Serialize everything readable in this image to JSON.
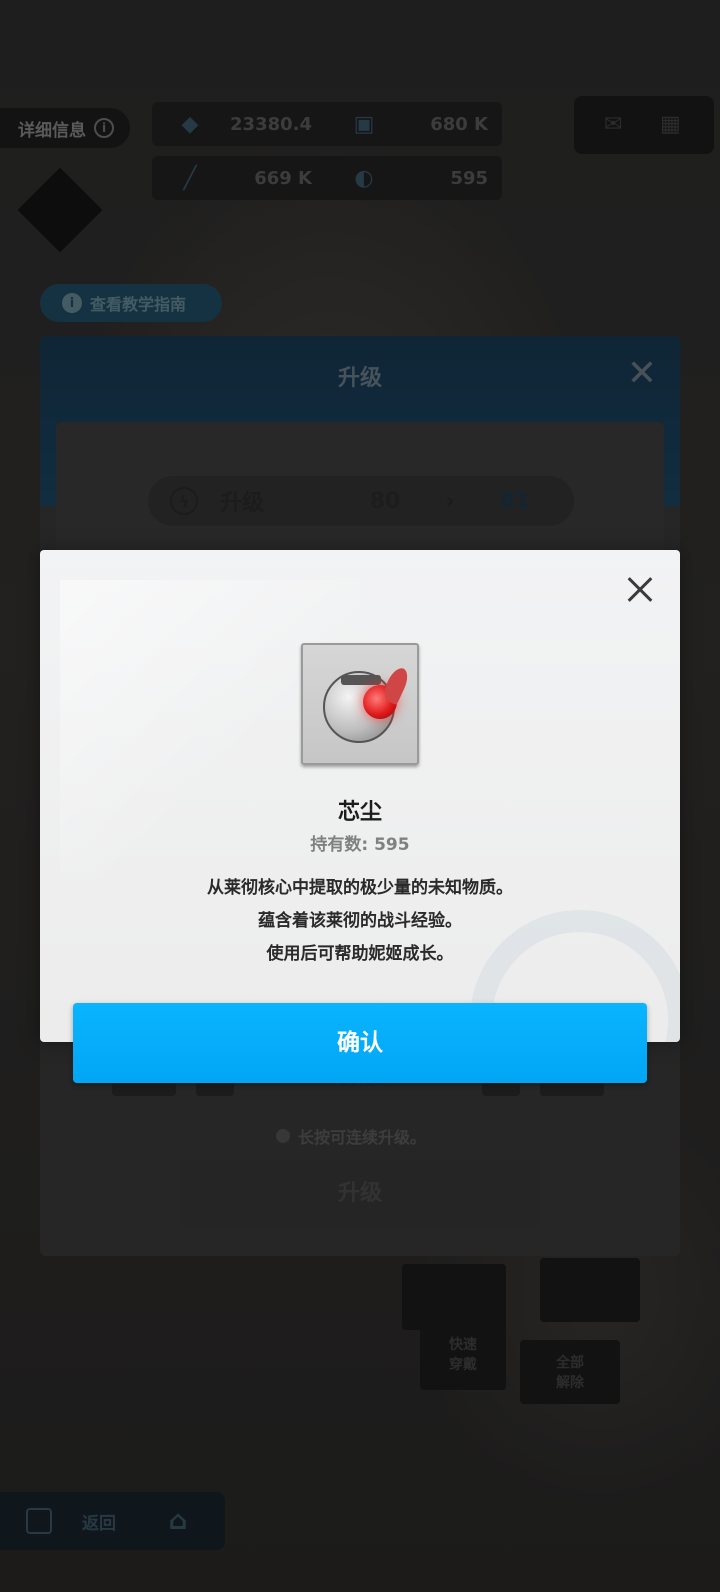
{
  "topbar": {
    "char_info_label": "详细信息",
    "resources": [
      {
        "icon": "credit-icon",
        "value": "23380.4"
      },
      {
        "icon": "box-icon",
        "value": "680 K"
      },
      {
        "icon": "syringe-icon",
        "value": "669 K"
      },
      {
        "icon": "core-dust-icon",
        "value": "595"
      }
    ]
  },
  "guide": {
    "label": "查看教学指南"
  },
  "upgrade_panel": {
    "title": "升级",
    "level_label": "升级",
    "level_from": "80",
    "level_arrow": "›",
    "level_to": "81",
    "level_indicator": "LV.81",
    "hold_hint": "长按可连续升级。",
    "upgrade_button": "升级",
    "quick_equip": "快速\n穿戴",
    "unequip_all": "全部\n解除"
  },
  "bottom_nav": {
    "back_label": "返回"
  },
  "modal": {
    "item_name": "芯尘",
    "count_label": "持有数: 595",
    "description_lines": [
      "从莱彻核心中提取的极少量的未知物质。",
      "蕴含着该莱彻的战斗经验。",
      "使用后可帮助妮姬成长。"
    ],
    "confirm_label": "确认"
  },
  "colors": {
    "confirm_button": "#02a6f4",
    "modal_background": "#efefef",
    "dim_overlay": "rgba(0,0,0,0.35)"
  }
}
